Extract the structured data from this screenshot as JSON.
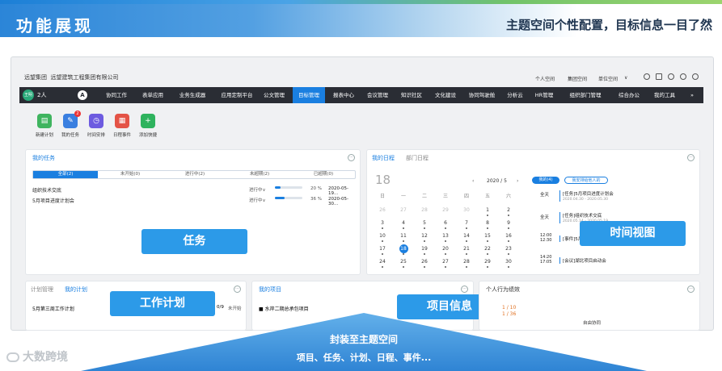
{
  "banner": {
    "title": "功能展现",
    "subtitle": "主题空间个性配置，目标信息一目了然"
  },
  "app": {
    "org_left": "远望集团",
    "org_right": "远望建筑工程集团有限公司",
    "header_links": [
      "个人空间",
      "集团空间",
      "单位空间"
    ],
    "header_icons": [
      "user-icon",
      "apps-icon",
      "search-icon",
      "chat-icon",
      "settings-icon"
    ],
    "avatar_text": "王明",
    "user_count": "2人",
    "nav": [
      "协同工作",
      "表单应用",
      "业务生成器",
      "应用定制平台",
      "公文管理",
      "目标管理",
      "报表中心",
      "会议管理",
      "知识社区",
      "文化建设",
      "协同驾驶舱",
      "分析云",
      "HR管理",
      "组织部门管理",
      "综合办公",
      "我的工具"
    ],
    "nav_active": "目标管理",
    "quick": [
      {
        "label": "新建计划",
        "color": "#3fb45f",
        "icon": "plan-icon",
        "glyph": "▤"
      },
      {
        "label": "我的任务",
        "color": "#3a7fe0",
        "icon": "task-icon",
        "glyph": "✎",
        "badge": "2"
      },
      {
        "label": "时间安排",
        "color": "#6d5be0",
        "icon": "clock-icon",
        "glyph": "◷"
      },
      {
        "label": "日程事件",
        "color": "#e45346",
        "icon": "event-icon",
        "glyph": "▦"
      },
      {
        "label": "添加快捷",
        "color": "#2fb35e",
        "icon": "plus-icon",
        "glyph": "+"
      }
    ]
  },
  "tasks": {
    "title": "我的任务",
    "tabs": [
      "全部(2)",
      "未开始(0)",
      "进行中(2)",
      "未超期(2)",
      "已超期(0)"
    ],
    "rows": [
      {
        "name": "组织技术交底",
        "status": "进行中∨",
        "progress": 20,
        "pct": "20 %",
        "date": "2020-05-19..."
      },
      {
        "name": "5月项目进度计划会",
        "status": "进行中∨",
        "progress": 36,
        "pct": "36 %",
        "date": "2020-05-30..."
      }
    ],
    "overlay": "任务"
  },
  "calendar": {
    "title_a": "我的日程",
    "title_b": "部门日程",
    "day": "18",
    "month": "2020 / 5",
    "weekdays": [
      "日",
      "一",
      "二",
      "三",
      "四",
      "五",
      "六"
    ],
    "weeks": [
      [
        "26",
        "27",
        "28",
        "29",
        "30",
        "1",
        "2"
      ],
      [
        "3",
        "4",
        "5",
        "6",
        "7",
        "8",
        "9"
      ],
      [
        "10",
        "11",
        "12",
        "13",
        "14",
        "15",
        "16"
      ],
      [
        "17",
        "18",
        "19",
        "20",
        "21",
        "22",
        "23"
      ],
      [
        "24",
        "25",
        "26",
        "27",
        "28",
        "29",
        "30"
      ]
    ],
    "today": "18",
    "sched_tab_a": "我的(4)",
    "sched_tab_b": "我安排给他人的",
    "sched": [
      {
        "time": "全天",
        "text": "[任务]5月项目进度计划会",
        "sub": "2020.04.30 - 2020.05.30"
      },
      {
        "time": "全天",
        "text": "[任务]组织技术交底",
        "sub": "2020.05.14 - 2020.05.19"
      },
      {
        "time": "12:00",
        "time2": "12:30",
        "text": "[事件]5月份项目进度..."
      },
      {
        "time": "14:20",
        "time2": "17:05",
        "text": "[会议]湖北项目启动会"
      }
    ],
    "overlay": "时间视图"
  },
  "plan": {
    "title_a": "计划管理",
    "title_b": "我的计划",
    "row": "5月第三周工作计划",
    "ratio": "0/9",
    "state": "未开始",
    "overlay": "工作计划"
  },
  "project": {
    "title": "我的项目",
    "row": "水岸二期总承包项目",
    "overlay": "项目信息"
  },
  "perf": {
    "title": "个人行为绩效",
    "v1": "1 / 10",
    "v2": "1 / 36",
    "foot": "自由协同"
  },
  "bottom": {
    "line1": "封装至主题空间",
    "line2": "项目、任务、计划、日程、事件..."
  },
  "watermark": "大数跨境"
}
